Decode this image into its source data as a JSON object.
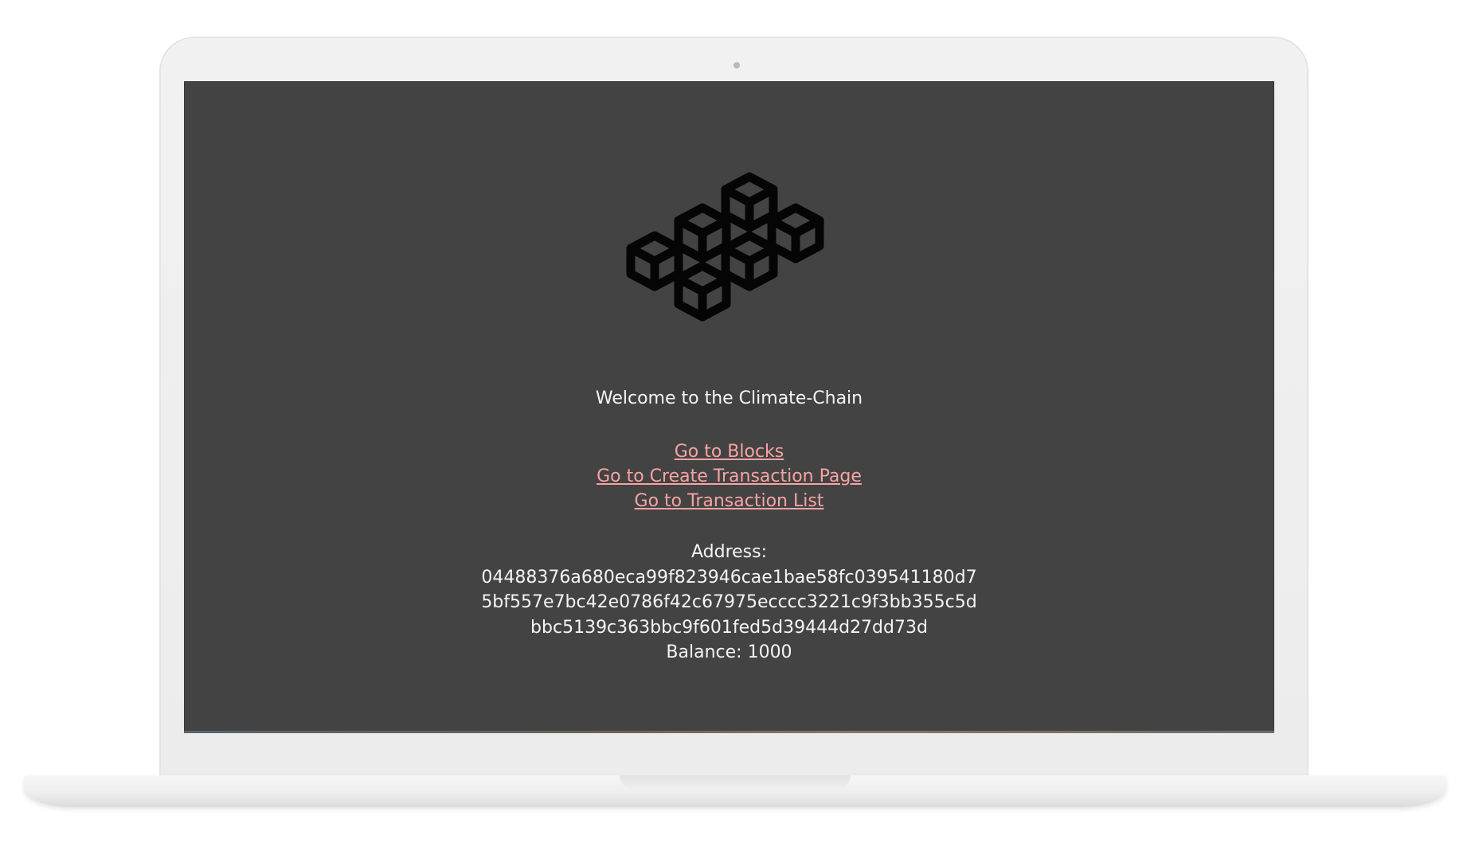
{
  "page": {
    "welcome_text": "Welcome to the Climate-Chain",
    "logo_icon": "blockchain-cubes-icon"
  },
  "nav": {
    "links": [
      {
        "label": "Go to Blocks"
      },
      {
        "label": "Go to Create Transaction Page"
      },
      {
        "label": "Go to Transaction List"
      }
    ]
  },
  "account": {
    "address_label": "Address:",
    "address_lines": [
      "04488376a680eca99f823946cae1bae58fc039541180d7",
      "5bf557e7bc42e0786f42c67975ecccc3221c9f3bb355c5d",
      "bbc5139c363bbc9f601fed5d39444d27dd73d"
    ],
    "balance": "Balance: 1000"
  },
  "colors": {
    "screen_bg": "#434343",
    "link": "#f7a3a3",
    "text": "#f4f4f4",
    "device_frame": "#efefef"
  }
}
